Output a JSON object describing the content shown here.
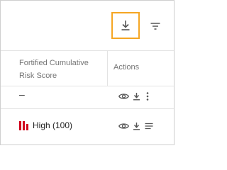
{
  "toolbar": {
    "download_icon": "download-icon",
    "filter_icon": "filter-icon",
    "highlight_color": "#f5a623"
  },
  "table": {
    "columns": [
      {
        "label": "Fortified Cumulative Risk Score"
      },
      {
        "label": "Actions"
      }
    ],
    "rows": [
      {
        "risk": "–",
        "actions": [
          "view-icon",
          "download-icon",
          "more-vertical-icon"
        ]
      },
      {
        "risk": "High (100)",
        "risk_level": "high",
        "risk_color": "#d0021b",
        "actions": [
          "view-icon",
          "download-icon",
          "menu-lines-icon"
        ]
      }
    ]
  }
}
